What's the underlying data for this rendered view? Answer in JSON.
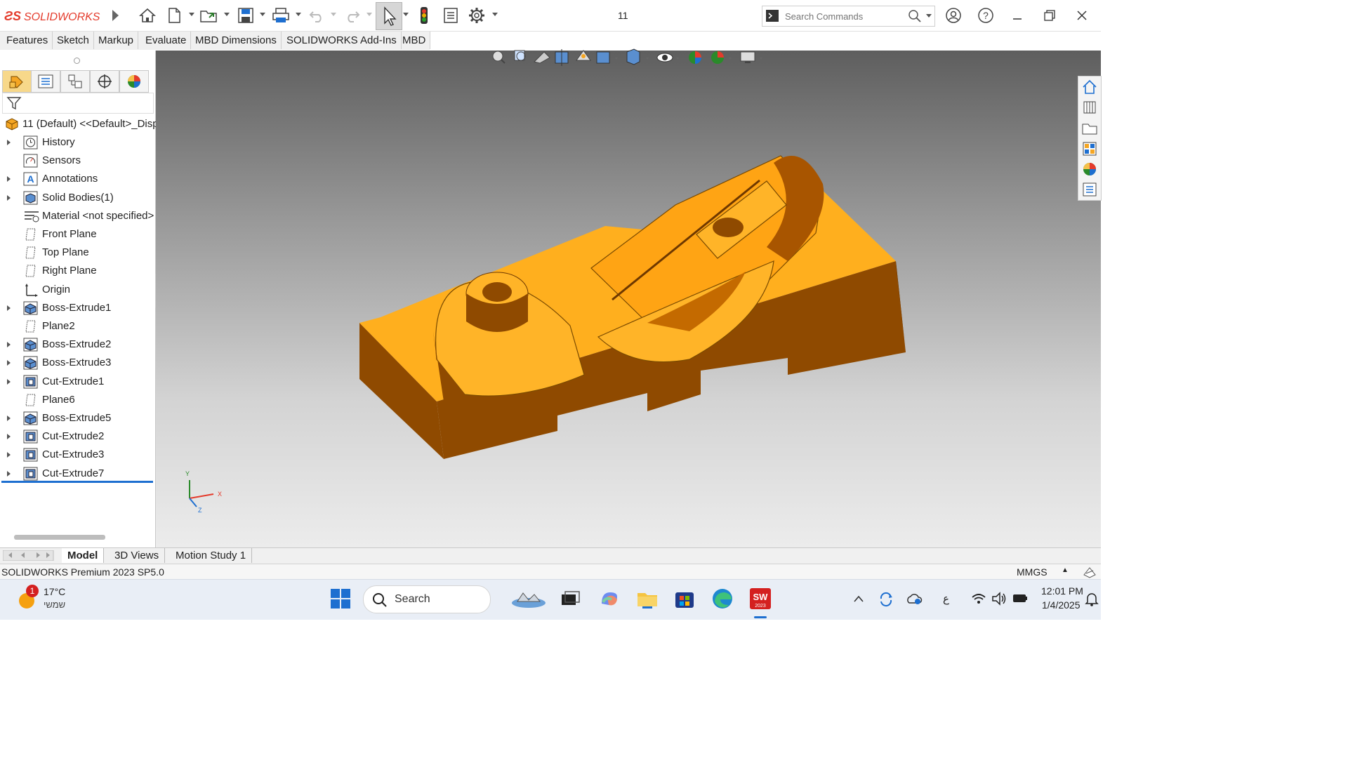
{
  "app": {
    "brand": "SOLIDWORKS",
    "doc_title": "11"
  },
  "search": {
    "placeholder": "Search Commands"
  },
  "command_tabs": [
    "Features",
    "Sketch",
    "Markup",
    "Evaluate",
    "MBD Dimensions",
    "SOLIDWORKS Add-Ins",
    "MBD"
  ],
  "tree": {
    "root": "11 (Default) <<Default>_Disp",
    "items": [
      {
        "label": "History",
        "icon": "history-icon",
        "expandable": true
      },
      {
        "label": "Sensors",
        "icon": "sensor-icon",
        "expandable": false
      },
      {
        "label": "Annotations",
        "icon": "annotations-icon",
        "expandable": true
      },
      {
        "label": "Solid Bodies(1)",
        "icon": "solid-bodies-icon",
        "expandable": true
      },
      {
        "label": "Material <not specified>",
        "icon": "material-icon",
        "expandable": false
      },
      {
        "label": "Front Plane",
        "icon": "plane-icon",
        "expandable": false
      },
      {
        "label": "Top Plane",
        "icon": "plane-icon",
        "expandable": false
      },
      {
        "label": "Right Plane",
        "icon": "plane-icon",
        "expandable": false
      },
      {
        "label": "Origin",
        "icon": "origin-icon",
        "expandable": false
      },
      {
        "label": "Boss-Extrude1",
        "icon": "boss-extrude-icon",
        "expandable": true
      },
      {
        "label": "Plane2",
        "icon": "plane-icon",
        "expandable": false
      },
      {
        "label": "Boss-Extrude2",
        "icon": "boss-extrude-icon",
        "expandable": true
      },
      {
        "label": "Boss-Extrude3",
        "icon": "boss-extrude-icon",
        "expandable": true
      },
      {
        "label": "Cut-Extrude1",
        "icon": "cut-extrude-icon",
        "expandable": true
      },
      {
        "label": "Plane6",
        "icon": "plane-icon",
        "expandable": false
      },
      {
        "label": "Boss-Extrude5",
        "icon": "boss-extrude-icon",
        "expandable": true
      },
      {
        "label": "Cut-Extrude2",
        "icon": "cut-extrude-icon",
        "expandable": true
      },
      {
        "label": "Cut-Extrude3",
        "icon": "cut-extrude-icon",
        "expandable": true
      },
      {
        "label": "Cut-Extrude7",
        "icon": "cut-extrude-icon",
        "expandable": true
      }
    ]
  },
  "triad": {
    "x": "X",
    "y": "Y",
    "z": "Z"
  },
  "bottom_tabs": [
    "Model",
    "3D Views",
    "Motion Study 1"
  ],
  "status": {
    "version": "SOLIDWORKS Premium 2023 SP5.0",
    "units": "MMGS"
  },
  "taskbar": {
    "weather_temp": "17°C",
    "weather_desc": "שמשי",
    "weather_badge": "1",
    "search_label": "Search",
    "lang": "ع",
    "time": "12:01 PM",
    "date": "1/4/2025",
    "sw_badge": "2023"
  },
  "colors": {
    "accent": "#e43b2c",
    "model": "#f5a623",
    "selection": "#1e6fd0"
  }
}
